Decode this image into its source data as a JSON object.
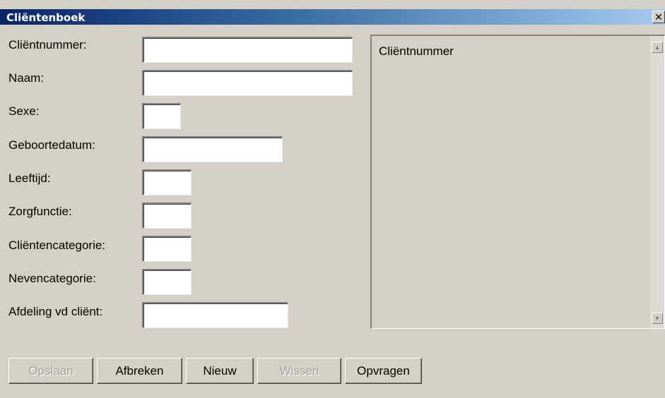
{
  "window": {
    "title": "Cliëntenboek",
    "close_glyph": "✕"
  },
  "form": {
    "fields": [
      {
        "label": "Cliëntnummer:",
        "value": ""
      },
      {
        "label": "Naam:",
        "value": ""
      },
      {
        "label": "Sexe:",
        "value": ""
      },
      {
        "label": "Geboortedatum:",
        "value": ""
      },
      {
        "label": "Leeftijd:",
        "value": ""
      },
      {
        "label": "Zorgfunctie:",
        "value": ""
      },
      {
        "label": "Cliëntencategorie:",
        "value": ""
      },
      {
        "label": "Nevencategorie:",
        "value": ""
      },
      {
        "label": "Afdeling vd cliënt:",
        "value": ""
      }
    ]
  },
  "list": {
    "header": "Cliëntnummer",
    "scroll_up_icon": "▲",
    "scroll_down_icon": "▼"
  },
  "buttons": {
    "save": "Opslaan",
    "cancel": "Afbreken",
    "new": "Nieuw",
    "clear": "Wissen",
    "query": "Opvragen"
  }
}
